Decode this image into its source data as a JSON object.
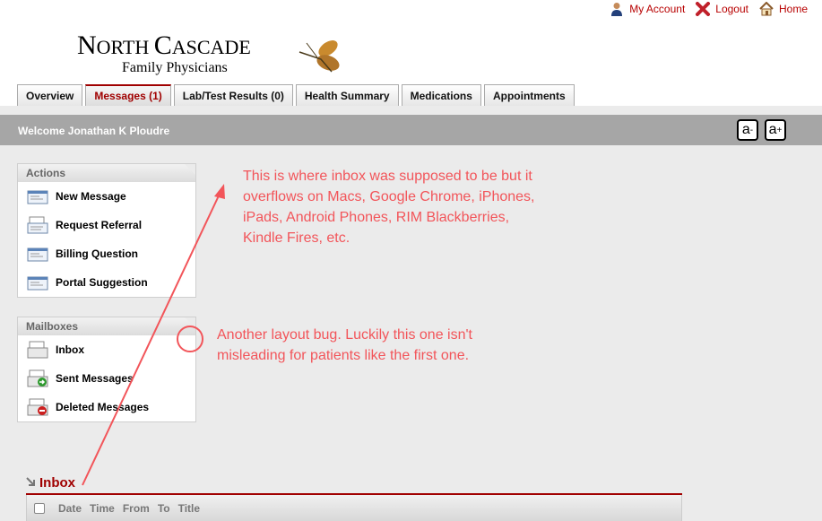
{
  "toplinks": {
    "account": "My Account",
    "logout": "Logout",
    "home": "Home"
  },
  "logo": {
    "n": "N",
    "orth": "ORTH ",
    "c": "C",
    "ascade": "ASCADE",
    "sub": "Family Physicians"
  },
  "tabs": [
    {
      "label": "Overview"
    },
    {
      "label": "Messages (1)"
    },
    {
      "label": "Lab/Test Results (0)"
    },
    {
      "label": "Health Summary"
    },
    {
      "label": "Medications"
    },
    {
      "label": "Appointments"
    }
  ],
  "welcome": "Welcome Jonathan K Ploudre",
  "font_controls": {
    "smaller": "a",
    "smaller_sign": "-",
    "larger": "a",
    "larger_sign": "+"
  },
  "actions": {
    "title": "Actions",
    "items": [
      {
        "label": "New Message"
      },
      {
        "label": "Request Referral"
      },
      {
        "label": "Billing Question"
      },
      {
        "label": "Portal Suggestion"
      }
    ]
  },
  "mailboxes": {
    "title": "Mailboxes",
    "items": [
      {
        "label": "Inbox"
      },
      {
        "label": "Sent Messages"
      },
      {
        "label": "Deleted Messages"
      }
    ]
  },
  "annotations": {
    "note1": [
      "This is where inbox was supposed to be but it",
      "overflows on Macs, Google Chrome, iPhones,",
      "iPads, Android Phones, RIM Blackberries,",
      "Kindle Fires, etc."
    ],
    "note2": [
      "Another layout bug. Luckily this one isn't",
      "misleading for patients like the first one."
    ]
  },
  "inbox": {
    "title": "Inbox",
    "columns": [
      "Date",
      "Time",
      "From",
      "To",
      "Title"
    ]
  },
  "colors": {
    "accent": "#a00000",
    "annotation": "#f2555a",
    "bar": "#a6a6a6"
  }
}
